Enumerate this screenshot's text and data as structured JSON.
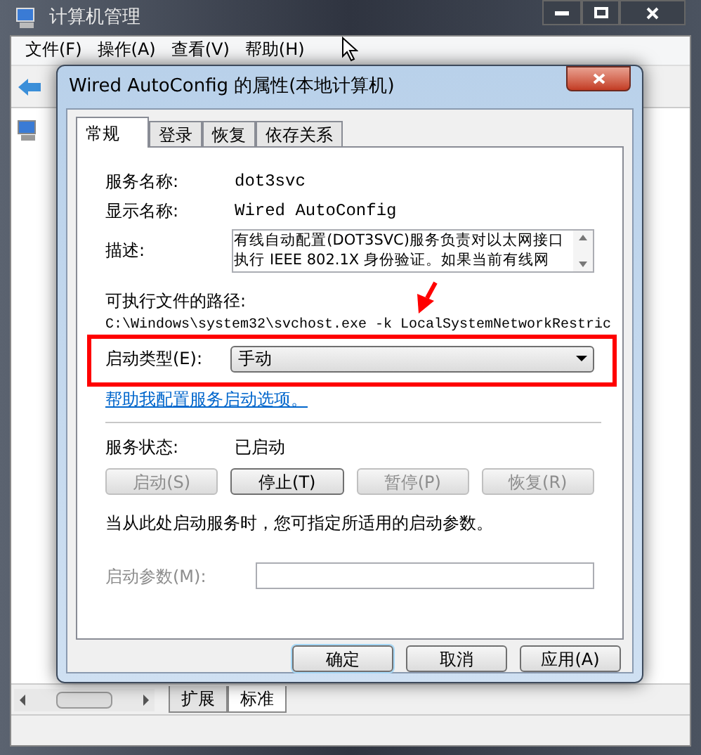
{
  "main_window": {
    "title": "计算机管理",
    "menu": [
      "文件(F)",
      "操作(A)",
      "查看(V)",
      "帮助(H)"
    ],
    "bottom_tabs": [
      {
        "label": "扩展",
        "selected": false
      },
      {
        "label": "标准",
        "selected": true
      }
    ]
  },
  "dialog": {
    "title": "Wired AutoConfig 的属性(本地计算机)",
    "tabs": [
      {
        "label": "常规",
        "selected": true
      },
      {
        "label": "登录",
        "selected": false
      },
      {
        "label": "恢复",
        "selected": false
      },
      {
        "label": "依存关系",
        "selected": false
      }
    ],
    "fields": [
      {
        "label": "服务名称:",
        "value": "dot3svc"
      },
      {
        "label": "显示名称:",
        "value": "Wired AutoConfig"
      }
    ],
    "description": {
      "label": "描述:",
      "lines": [
        "有线自动配置(DOT3SVC)服务负责对以太网接口",
        "执行 IEEE 802.1X 身份验证。如果当前有线网"
      ]
    },
    "path_label": "可执行文件的路径:",
    "path": "C:\\Windows\\system32\\svchost.exe -k LocalSystemNetworkRestric",
    "startup_type": {
      "label": "启动类型(E):",
      "value": "手动"
    },
    "help_link": "帮助我配置服务启动选项。",
    "status": {
      "label": "服务状态:",
      "value": "已启动"
    },
    "service_buttons": [
      {
        "label": "启动(S)",
        "disabled": true
      },
      {
        "label": "停止(T)",
        "disabled": false
      },
      {
        "label": "暂停(P)",
        "disabled": true
      },
      {
        "label": "恢复(R)",
        "disabled": true
      }
    ],
    "hint": "当从此处启动服务时，您可指定所适用的启动参数。",
    "params": {
      "label": "启动参数(M):",
      "disabled": true
    },
    "buttons": [
      {
        "label": "确定",
        "default": true
      },
      {
        "label": "取消",
        "default": false
      },
      {
        "label": "应用(A)",
        "default": false
      }
    ]
  }
}
